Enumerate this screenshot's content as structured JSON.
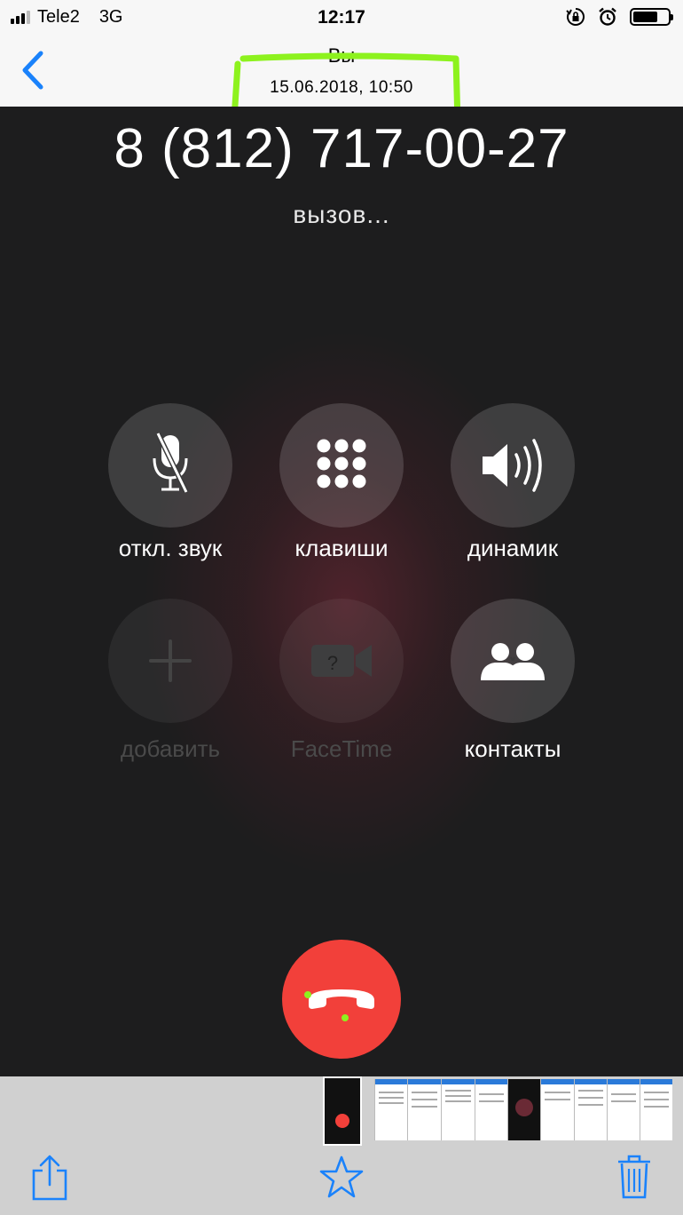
{
  "status_bar": {
    "carrier": "Tele2",
    "network": "3G",
    "time": "12:17"
  },
  "nav": {
    "title": "Вы",
    "subtitle": "15.06.2018, 10:50"
  },
  "call": {
    "number": "8 (812) 717-00-27",
    "status": "вызов..."
  },
  "buttons": {
    "mute": "откл. звук",
    "keypad": "клавиши",
    "speaker": "динамик",
    "add": "добавить",
    "facetime": "FaceTime",
    "contacts": "контакты"
  },
  "colors": {
    "accent": "#1a82fb",
    "end_call": "#f2403a",
    "highlight": "#8df21e"
  },
  "icons": [
    "back-chevron-icon",
    "microphone-muted-icon",
    "keypad-icon",
    "speaker-icon",
    "plus-icon",
    "facetime-camera-icon",
    "contacts-icon",
    "end-call-icon",
    "share-icon",
    "star-icon",
    "trash-icon"
  ]
}
